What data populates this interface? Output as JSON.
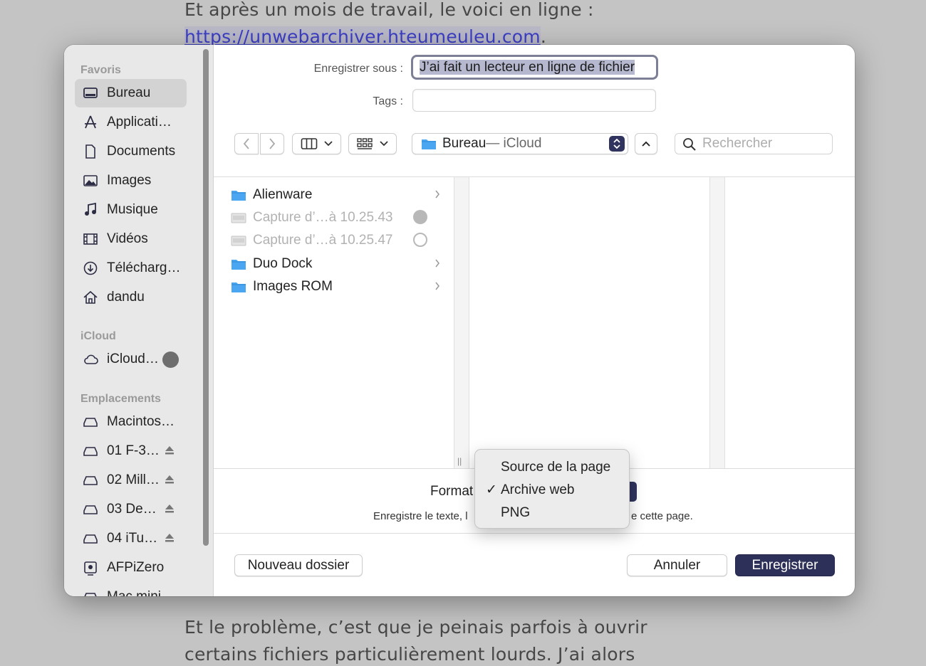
{
  "background": {
    "top_line": "Et après un mois de travail, le voici en ligne :",
    "link": "https://unwebarchiver.hteumeuleu.com",
    "link_suffix": ".",
    "bottom_line1": "Et le problème, c’est que je peinais parfois à ouvrir",
    "bottom_line2": "certains fichiers particulièrement lourds. J’ai alors"
  },
  "sidebar": {
    "favorites_title": "Favoris",
    "favorites": [
      {
        "label": "Bureau",
        "icon": "desktop-icon",
        "selected": true
      },
      {
        "label": "Applicati…",
        "icon": "applications-icon"
      },
      {
        "label": "Documents",
        "icon": "document-icon"
      },
      {
        "label": "Images",
        "icon": "photo-icon"
      },
      {
        "label": "Musique",
        "icon": "music-icon"
      },
      {
        "label": "Vidéos",
        "icon": "film-icon"
      },
      {
        "label": "Télécharg…",
        "icon": "download-icon"
      },
      {
        "label": "dandu",
        "icon": "home-icon"
      }
    ],
    "icloud_title": "iCloud",
    "icloud": [
      {
        "label": "iCloud…",
        "icon": "cloud-icon"
      }
    ],
    "locations_title": "Emplacements",
    "locations": [
      {
        "label": "Macintos…",
        "icon": "drive-icon"
      },
      {
        "label": "01 F-3…",
        "icon": "drive-icon",
        "eject": true
      },
      {
        "label": "02 Mill…",
        "icon": "drive-icon",
        "eject": true
      },
      {
        "label": "03 De…",
        "icon": "drive-icon",
        "eject": true
      },
      {
        "label": "04 iTu…",
        "icon": "drive-icon",
        "eject": true
      },
      {
        "label": "AFPiZero",
        "icon": "server-icon"
      },
      {
        "label": "Mac mini",
        "icon": "drive-icon"
      }
    ]
  },
  "save": {
    "save_as_label": "Enregistrer sous :",
    "filename": "J’ai fait un lecteur en ligne de fichier",
    "tags_label": "Tags :"
  },
  "toolbar": {
    "location": "Bureau",
    "location_suffix": " — iCloud",
    "search_placeholder": "Rechercher"
  },
  "files": [
    {
      "name": "Alienware",
      "type": "folder",
      "chevron": true
    },
    {
      "name": "Capture d’…à 10.25.43",
      "type": "image",
      "dim": true,
      "status": "filled"
    },
    {
      "name": "Capture d’…à 10.25.47",
      "type": "image",
      "dim": true,
      "status": "outline"
    },
    {
      "name": "Duo Dock",
      "type": "folder",
      "chevron": true
    },
    {
      "name": "Images ROM",
      "type": "folder",
      "chevron": true
    }
  ],
  "format": {
    "label": "Format",
    "desc_left": "Enregistre le texte, l",
    "desc_right": "e cette page.",
    "options": [
      {
        "label": "Source de la page",
        "checked": false
      },
      {
        "label": "Archive web",
        "checked": true
      },
      {
        "label": "PNG",
        "checked": false
      }
    ]
  },
  "buttons": {
    "new_folder": "Nouveau dossier",
    "cancel": "Annuler",
    "save": "Enregistrer"
  },
  "colors": {
    "accent": "#2d3058",
    "folder": "#4aa6f0",
    "sidebar_bg": "#e8e8e8"
  }
}
